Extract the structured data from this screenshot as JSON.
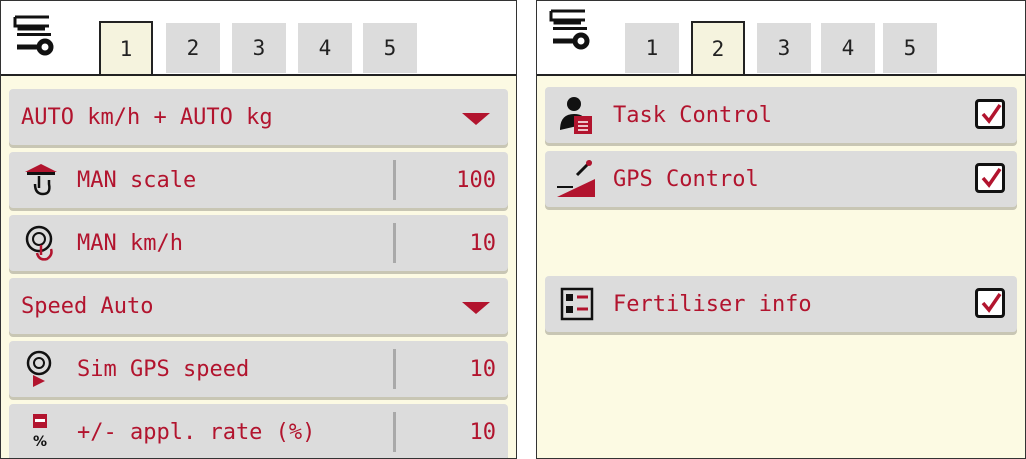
{
  "left_panel": {
    "tabs": [
      "1",
      "2",
      "3",
      "4",
      "5"
    ],
    "active_tab": "1",
    "rows": {
      "mode_select": "AUTO km/h + AUTO kg",
      "man_scale": {
        "label": "MAN scale",
        "value": "100"
      },
      "man_kmh": {
        "label": "MAN km/h",
        "value": "10"
      },
      "speed_select": "Speed Auto",
      "sim_gps": {
        "label": "Sim GPS speed",
        "value": "10"
      },
      "appl_rate": {
        "label": "+/- appl. rate (%)",
        "value": "10"
      }
    }
  },
  "right_panel": {
    "tabs": [
      "1",
      "2",
      "3",
      "4",
      "5"
    ],
    "active_tab": "2",
    "rows": {
      "task_control": {
        "label": "Task Control",
        "checked": true
      },
      "gps_control": {
        "label": "GPS Control",
        "checked": true
      },
      "fertiliser_info": {
        "label": "Fertiliser info",
        "checked": true
      }
    }
  },
  "icons": {
    "menu": "menu-tool-icon",
    "man_scale": "hand-scale-icon",
    "man_kmh": "hand-speedometer-icon",
    "sim_gps": "speedometer-play-icon",
    "appl_rate": "weight-percent-icon",
    "task_control": "operator-clipboard-icon",
    "gps_control": "gps-field-icon",
    "fertiliser_info": "info-list-icon"
  },
  "colors": {
    "text": "#b2142e",
    "row_bg": "#dcdcdc",
    "panel_bg": "#fcfae3"
  }
}
